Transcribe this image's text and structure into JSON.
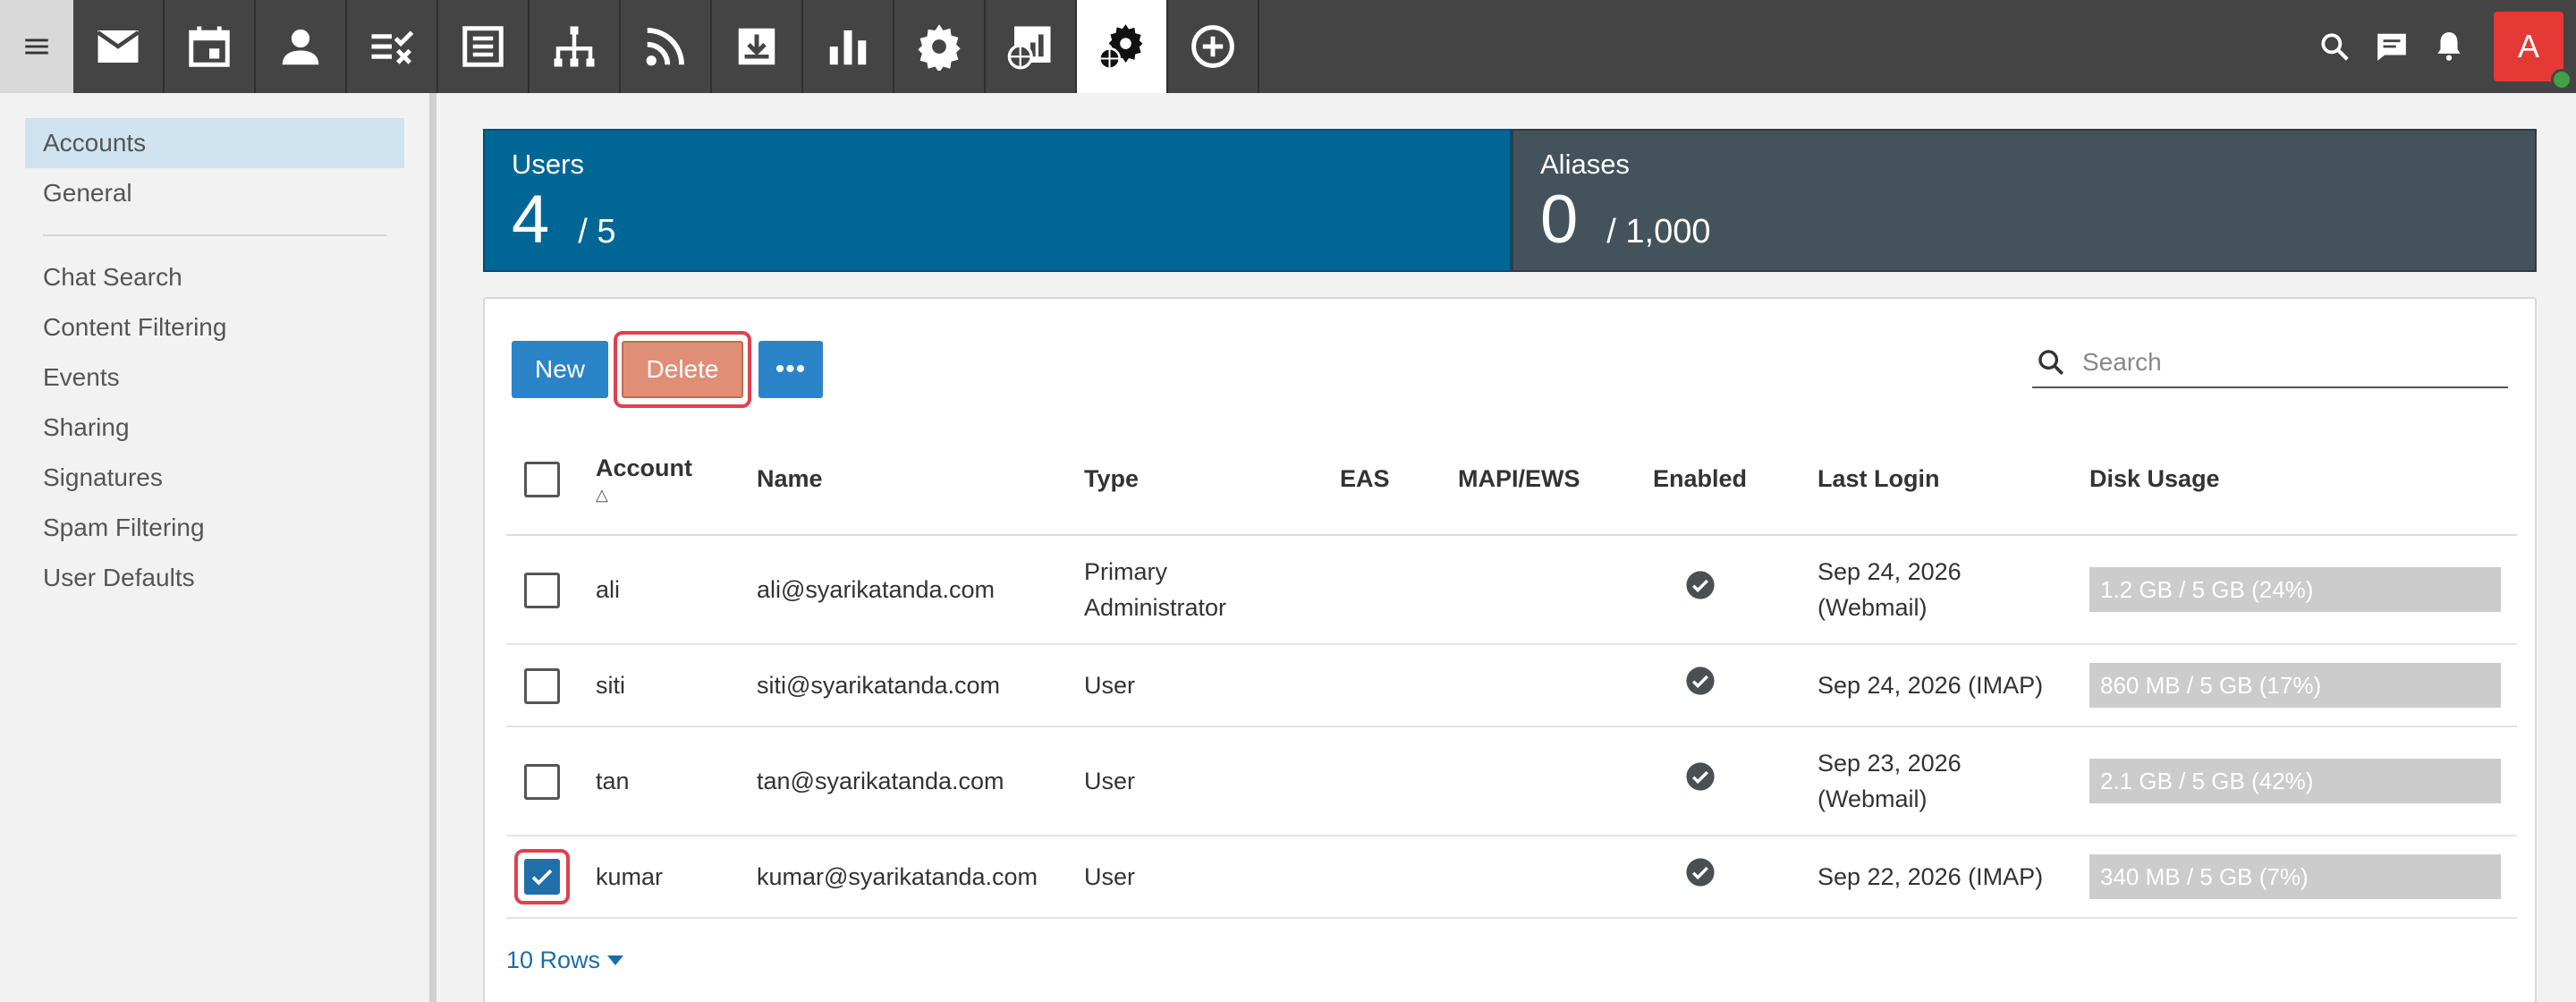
{
  "topbar": {
    "apps": [
      {
        "name": "mail-icon"
      },
      {
        "name": "calendar-icon"
      },
      {
        "name": "contacts-icon"
      },
      {
        "name": "tasks-icon"
      },
      {
        "name": "notes-icon"
      },
      {
        "name": "sitemap-icon"
      },
      {
        "name": "rss-icon"
      },
      {
        "name": "download-icon"
      },
      {
        "name": "reports-icon"
      },
      {
        "name": "settings-icon"
      },
      {
        "name": "domain-reports-icon"
      },
      {
        "name": "domain-settings-icon"
      },
      {
        "name": "add-circle-icon"
      }
    ],
    "avatar_initial": "A"
  },
  "sidebar": {
    "items": [
      "Accounts",
      "General"
    ],
    "items2": [
      "Chat Search",
      "Content Filtering",
      "Events",
      "Sharing",
      "Signatures",
      "Spam Filtering",
      "User Defaults"
    ]
  },
  "stats": {
    "users_label": "Users",
    "users_count": "4",
    "users_limit": "/ 5",
    "aliases_label": "Aliases",
    "aliases_count": "0",
    "aliases_limit": "/ 1,000"
  },
  "toolbar": {
    "new_label": "New",
    "delete_label": "Delete",
    "more_label": "•••",
    "search_placeholder": "Search"
  },
  "table": {
    "headers": {
      "account": "Account",
      "name": "Name",
      "type": "Type",
      "eas": "EAS",
      "mapi": "MAPI/EWS",
      "enabled": "Enabled",
      "last_login": "Last Login",
      "disk": "Disk Usage"
    },
    "sort_indicator": "△",
    "rows": [
      {
        "account": "ali",
        "name": "ali@syarikatanda.com",
        "type": "Primary Administrator",
        "last_login": "Sep 24, 2026 (Webmail)",
        "disk": "1.2 GB / 5 GB (24%)",
        "checked": false
      },
      {
        "account": "siti",
        "name": "siti@syarikatanda.com",
        "type": "User",
        "last_login": "Sep 24, 2026 (IMAP)",
        "disk": "860 MB / 5 GB (17%)",
        "checked": false
      },
      {
        "account": "tan",
        "name": "tan@syarikatanda.com",
        "type": "User",
        "last_login": "Sep 23, 2026 (Webmail)",
        "disk": "2.1 GB / 5 GB (42%)",
        "checked": false
      },
      {
        "account": "kumar",
        "name": "kumar@syarikatanda.com",
        "type": "User",
        "last_login": "Sep 22, 2026 (IMAP)",
        "disk": "340 MB / 5 GB (7%)",
        "checked": true
      }
    ]
  },
  "footer": {
    "rows_label": "10 Rows"
  }
}
